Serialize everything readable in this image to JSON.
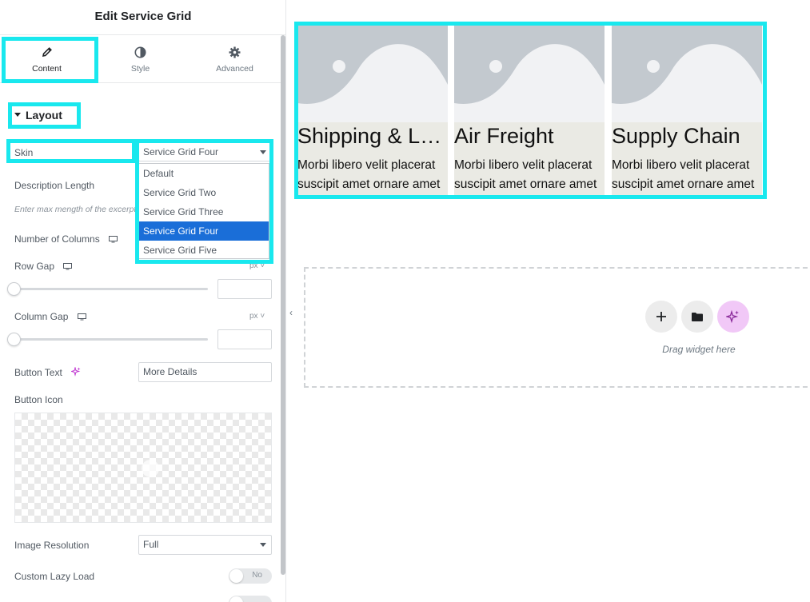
{
  "panel": {
    "title": "Edit Service Grid",
    "tabs": [
      {
        "label": "Content",
        "icon": "pencil-icon"
      },
      {
        "label": "Style",
        "icon": "contrast-icon"
      },
      {
        "label": "Advanced",
        "icon": "gear-icon"
      }
    ],
    "section": "Layout"
  },
  "controls": {
    "skin": {
      "label": "Skin",
      "value": "Service Grid Four"
    },
    "skin_options": [
      "Default",
      "Service Grid Two",
      "Service Grid Three",
      "Service Grid Four",
      "Service Grid Five"
    ],
    "description_length": {
      "label": "Description Length",
      "note": "Enter max mength of the excerpt"
    },
    "columns": {
      "label": "Number of Columns"
    },
    "row_gap": {
      "label": "Row Gap",
      "unit": "px"
    },
    "column_gap": {
      "label": "Column Gap",
      "unit": "px"
    },
    "button_text": {
      "label": "Button Text",
      "value": "More Details"
    },
    "button_icon": {
      "label": "Button Icon"
    },
    "image_resolution": {
      "label": "Image Resolution",
      "value": "Full"
    },
    "lazy_load": {
      "label": "Custom Lazy Load",
      "state": "No"
    }
  },
  "preview": {
    "cards": [
      {
        "title": "Shipping & Logistics",
        "line1": "Morbi libero velit placerat",
        "line2": "suscipit amet ornare amet"
      },
      {
        "title": "Air Freight",
        "line1": "Morbi libero velit placerat",
        "line2": "suscipit amet ornare amet"
      },
      {
        "title": "Supply Chain",
        "line1": "Morbi libero velit placerat",
        "line2": "suscipit amet ornare amet"
      }
    ],
    "drop_text": "Drag widget here"
  },
  "colors": {
    "highlight": "#19e8ee",
    "selected": "#1a6ed8",
    "ai_button": "#f1c8f7"
  }
}
